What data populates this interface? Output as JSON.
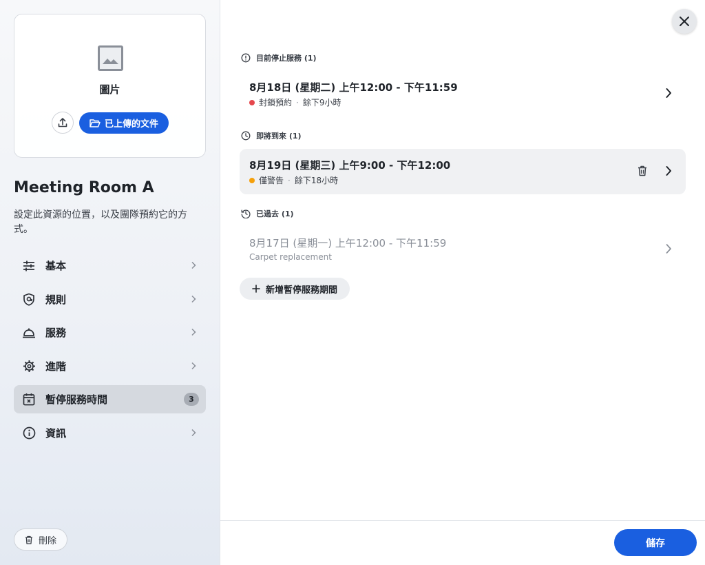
{
  "sidebar": {
    "upload_label": "圖片",
    "uploaded_button": "已上傳的文件",
    "title": "Meeting Room A",
    "description": "設定此資源的位置，以及團隊預約它的方式。",
    "nav": [
      {
        "label": "基本",
        "icon": "sliders-icon"
      },
      {
        "label": "規則",
        "icon": "shield-icon"
      },
      {
        "label": "服務",
        "icon": "service-bell-icon"
      },
      {
        "label": "進階",
        "icon": "gear-icon"
      },
      {
        "label": "暫停服務時間",
        "icon": "calendar-x-icon",
        "badge": "3",
        "active": true
      },
      {
        "label": "資訊",
        "icon": "info-icon"
      }
    ],
    "delete_label": "刪除"
  },
  "sections": {
    "current": {
      "heading": "目前停止服務 (1)",
      "items": [
        {
          "title": "8月18日 (星期二) 上午12:00 - 下午11:59",
          "status": "封鎖預約",
          "remaining": "餘下9小時",
          "status_color": "#e5484d"
        }
      ]
    },
    "upcoming": {
      "heading": "即將到來 (1)",
      "items": [
        {
          "title": "8月19日 (星期三) 上午9:00 - 下午12:00",
          "status": "僅警告",
          "remaining": "餘下18小時",
          "status_color": "#f5a00b"
        }
      ]
    },
    "past": {
      "heading": "已過去 (1)",
      "items": [
        {
          "title": "8月17日 (星期一) 上午12:00 - 下午11:59",
          "note": "Carpet replacement"
        }
      ]
    }
  },
  "add_button": "新增暫停服務期間",
  "save_button": "儲存",
  "colors": {
    "accent": "#1a5fe0",
    "active_nav": "#d5d9df"
  }
}
